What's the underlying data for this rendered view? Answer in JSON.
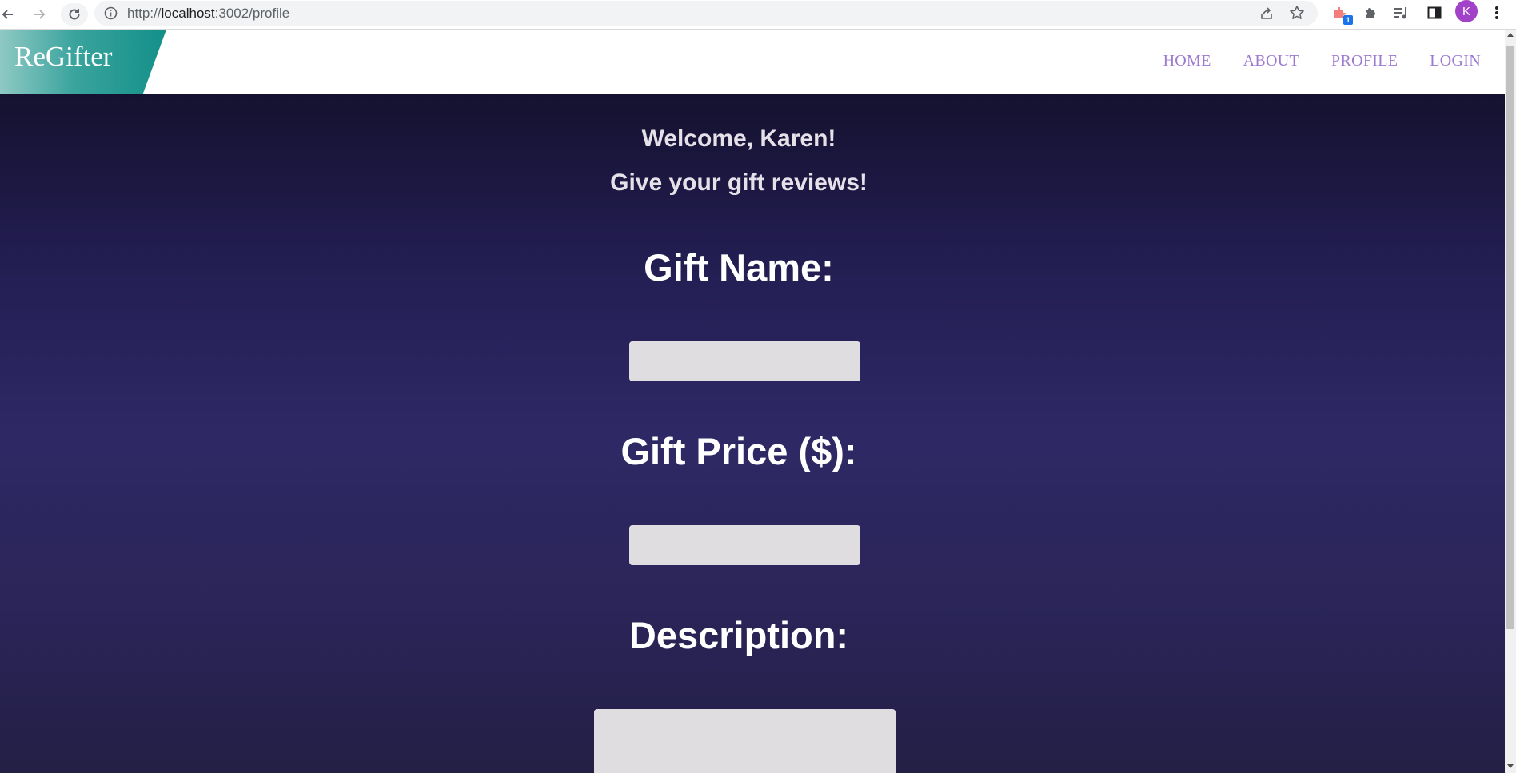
{
  "browser": {
    "url_scheme": "http://",
    "url_host": "localhost",
    "url_rest": ":3002/profile",
    "extension_badge": "1",
    "profile_initial": "K"
  },
  "header": {
    "brand": "ReGifter",
    "nav": [
      {
        "label": "HOME"
      },
      {
        "label": "ABOUT"
      },
      {
        "label": "PROFILE"
      },
      {
        "label": "LOGIN"
      }
    ]
  },
  "main": {
    "welcome": "Welcome, Karen!",
    "subtitle": "Give your gift reviews!",
    "gift_name_label": "Gift Name:",
    "gift_name_value": "",
    "gift_price_label": "Gift Price ($):",
    "gift_price_value": "",
    "description_label": "Description:",
    "description_value": ""
  },
  "colors": {
    "brand_gradient_start": "#8fc9c4",
    "brand_gradient_end": "#139089",
    "nav_link": "#9b7ad0",
    "background_top": "#15112f",
    "background_mid": "#2e2865",
    "input_bg": "#dfdde0"
  }
}
